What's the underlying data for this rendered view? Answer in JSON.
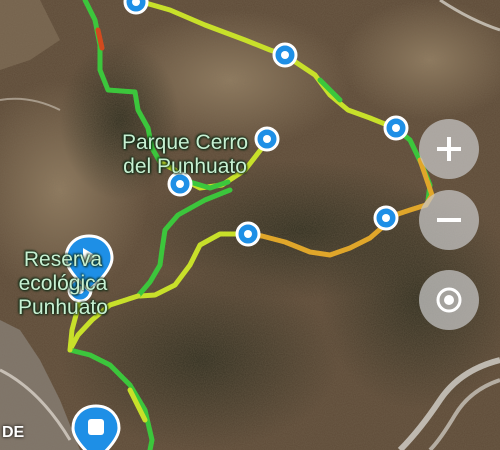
{
  "map": {
    "labels": {
      "park_line1": "Parque Cerro",
      "park_line2": "del Punhuato",
      "reserve_line1": "Reserva",
      "reserve_line2": "ecológica",
      "reserve_line3": "Punhuato",
      "edge_text": "DE"
    },
    "route": {
      "speed_colors": [
        "#3cc63c",
        "#c8e02a",
        "#e0a62a",
        "#d24a1e"
      ]
    },
    "waypoint_count": 10,
    "controls": {
      "zoom_in_icon": "plus-icon",
      "zoom_out_icon": "minus-icon",
      "locate_icon": "location-target-icon"
    },
    "markers": {
      "start_icon": "play-icon",
      "end_icon": "stop-icon",
      "pin_color": "#1e8fe6"
    }
  }
}
